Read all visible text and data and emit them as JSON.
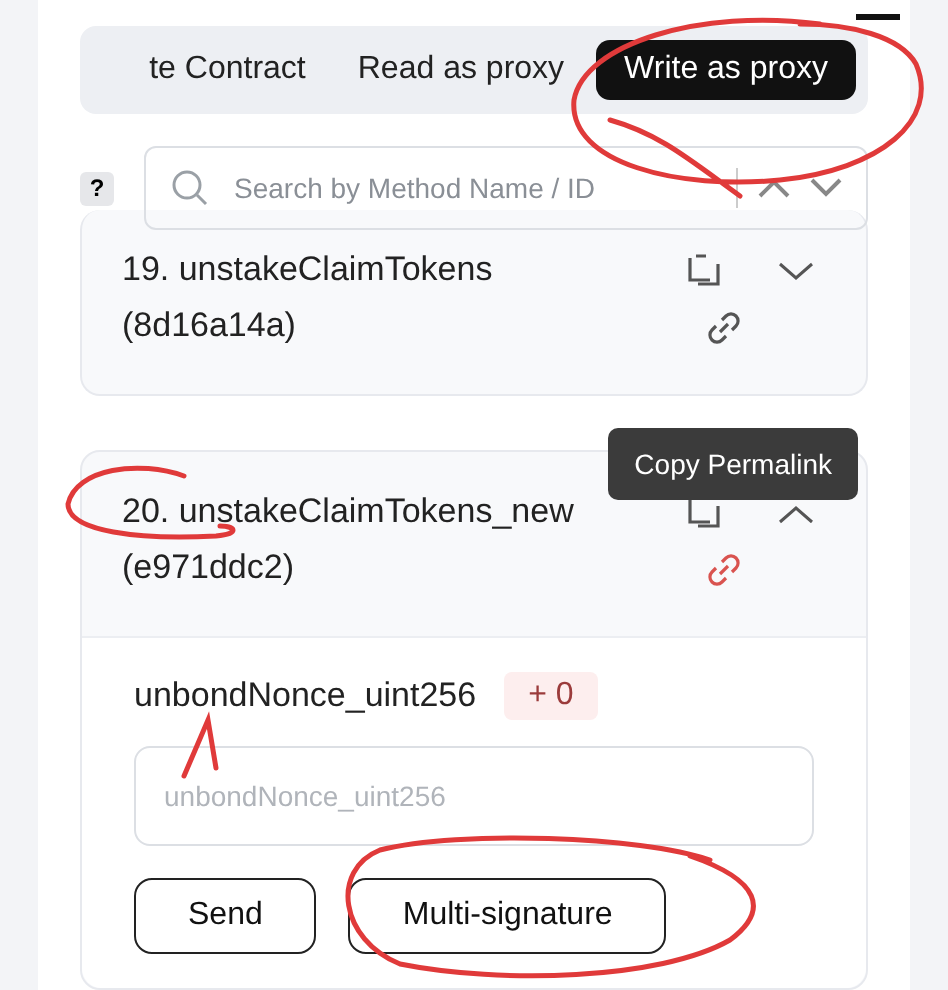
{
  "tabs": [
    {
      "label": "te Contract",
      "selected": false
    },
    {
      "label": "Read as proxy",
      "selected": false
    },
    {
      "label": "Write as proxy",
      "selected": true
    }
  ],
  "help": "?",
  "search": {
    "placeholder": "Search by Method Name / ID"
  },
  "methods": [
    {
      "title": "19. unstakeClaimTokens",
      "selector": "(8d16a14a)",
      "expanded": false,
      "link_hovered": false
    },
    {
      "title": "20. unstakeClaimTokens_new",
      "selector": "(e971ddc2)",
      "expanded": true,
      "link_hovered": true,
      "tooltip": "Copy Permalink",
      "params": [
        {
          "name": "unbondNonce_uint256",
          "badge": "+ 0",
          "placeholder": "unbondNonce_uint256"
        }
      ],
      "buttons": [
        "Send",
        "Multi-signature"
      ]
    }
  ],
  "annotations": [
    {
      "kind": "loop"
    },
    {
      "kind": "arc"
    },
    {
      "kind": "caret"
    },
    {
      "kind": "ellipse"
    }
  ]
}
